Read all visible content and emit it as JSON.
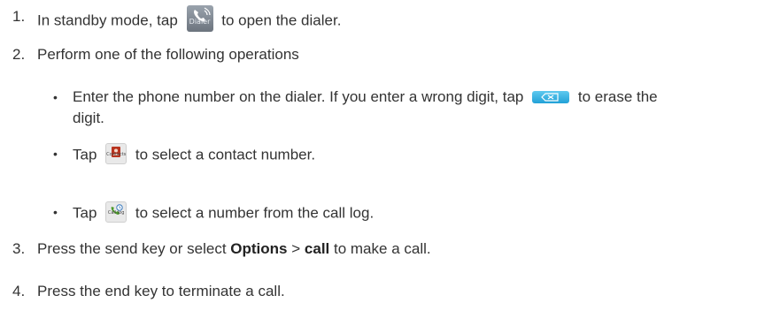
{
  "steps": {
    "s1": {
      "num": "1.",
      "before": "In standby mode, tap",
      "after": "to open the dialer.",
      "icon_label": "Dialer"
    },
    "s2": {
      "num": "2.",
      "text": "Perform one of the following operations"
    },
    "b1": {
      "bullet": "•",
      "before": "Enter the phone number on the dialer. If you enter a wrong digit, tap",
      "after": "to erase the",
      "cont": "digit."
    },
    "b2": {
      "bullet": "•",
      "before": "Tap",
      "after": "to select a contact number.",
      "icon_label": "Contacts"
    },
    "b3": {
      "bullet": "•",
      "before": "Tap",
      "after": "to select a number from the call log.",
      "icon_label": "Call log"
    },
    "s3": {
      "num": "3.",
      "before": "Press the send key or select",
      "bold1": "Options",
      "sep": ">",
      "bold2": "call",
      "after": "to make a call."
    },
    "s4": {
      "num": "4.",
      "text": "Press the end key to terminate a call."
    }
  }
}
